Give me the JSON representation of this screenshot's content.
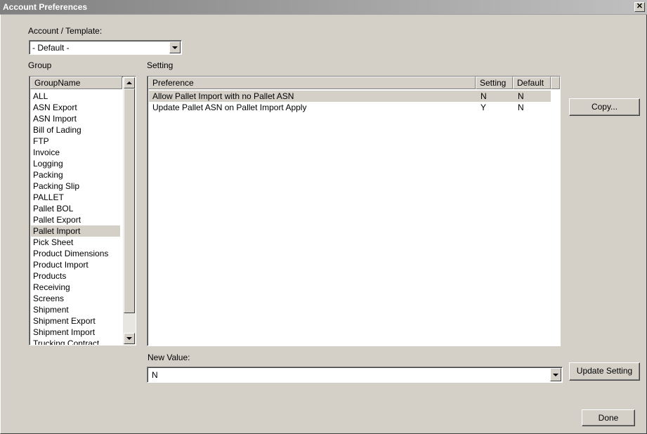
{
  "window": {
    "title": "Account Preferences",
    "close_glyph": "✕"
  },
  "account_template": {
    "label": "Account / Template:",
    "value": "- Default -"
  },
  "group": {
    "label": "Group",
    "column": "GroupName",
    "items": [
      "ALL",
      "ASN Export",
      "ASN Import",
      "Bill of Lading",
      "FTP",
      "Invoice",
      "Logging",
      "Packing",
      "Packing Slip",
      "PALLET",
      "Pallet BOL",
      "Pallet Export",
      "Pallet Import",
      "Pick Sheet",
      "Product Dimensions",
      "Product Import",
      "Products",
      "Receiving",
      "Screens",
      "Shipment",
      "Shipment Export",
      "Shipment Import",
      "Trucking Contract"
    ],
    "selected": "Pallet Import"
  },
  "setting": {
    "label": "Setting",
    "columns": {
      "preference": "Preference",
      "setting": "Setting",
      "default": "Default"
    },
    "rows": [
      {
        "preference": "Allow Pallet Import with no Pallet ASN",
        "setting": "N",
        "default": "N"
      },
      {
        "preference": "Update Pallet ASN on Pallet Import Apply",
        "setting": "Y",
        "default": "N"
      }
    ]
  },
  "new_value": {
    "label": "New Value:",
    "value": "N"
  },
  "buttons": {
    "copy": "Copy...",
    "update": "Update Setting",
    "done": "Done"
  }
}
